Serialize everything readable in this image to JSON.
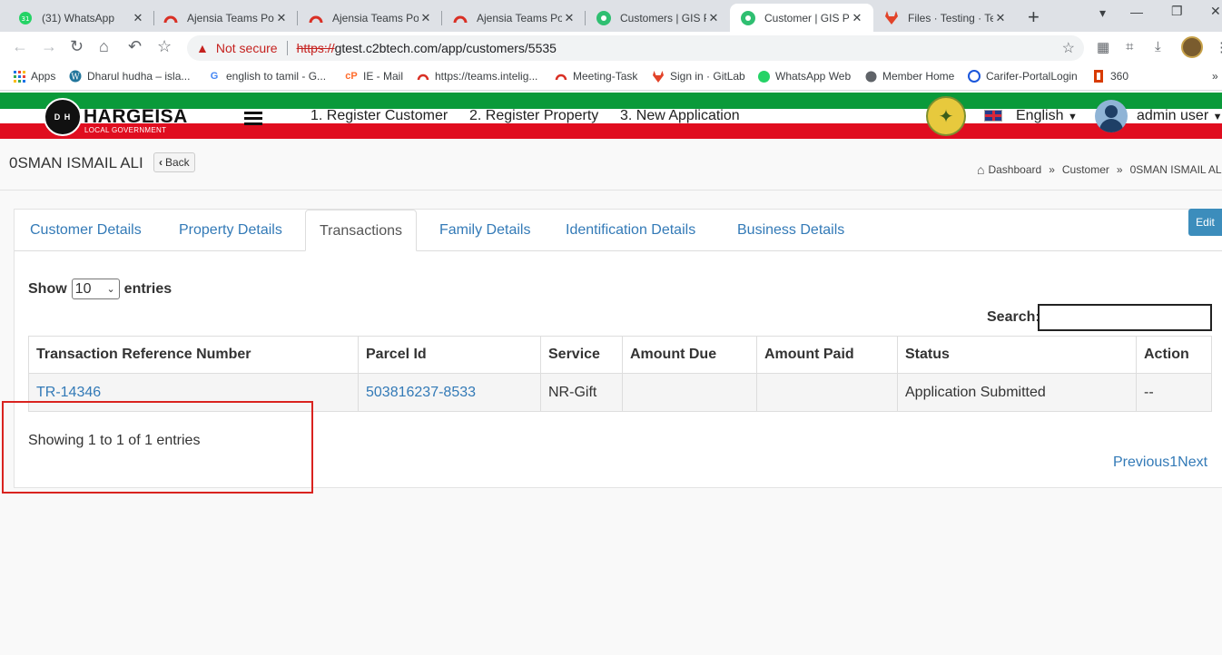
{
  "browser": {
    "tabs": [
      {
        "title": "(31) WhatsApp",
        "icon": "whatsapp-icon",
        "active": false
      },
      {
        "title": "Ajensia Teams Por",
        "icon": "teams-icon",
        "active": false
      },
      {
        "title": "Ajensia Teams Por",
        "icon": "teams-icon",
        "active": false
      },
      {
        "title": "Ajensia Teams Por",
        "icon": "teams-icon",
        "active": false
      },
      {
        "title": "Customers | GIS P",
        "icon": "gis-icon",
        "active": false
      },
      {
        "title": "Customer | GIS Po",
        "icon": "gis-icon",
        "active": true
      },
      {
        "title": "Files · Testing · Te",
        "icon": "gitlab-icon",
        "active": false
      }
    ],
    "not_secure": "Not secure",
    "url_scheme": "https://",
    "url_rest": "gtest.c2btech.com/app/customers/5535",
    "bookmarks": [
      {
        "label": "Apps",
        "icon": "apps-grid-icon"
      },
      {
        "label": "Dharul hudha – isla...",
        "icon": "wordpress-icon"
      },
      {
        "label": "english to tamil - G...",
        "icon": "google-icon"
      },
      {
        "label": "IE - Mail",
        "icon": "cpanel-icon"
      },
      {
        "label": "https://teams.intelig...",
        "icon": "teams-icon"
      },
      {
        "label": "Meeting-Task",
        "icon": "teams-icon"
      },
      {
        "label": "Sign in · GitLab",
        "icon": "gitlab-icon"
      },
      {
        "label": "WhatsApp Web",
        "icon": "whatsapp-icon"
      },
      {
        "label": "Member Home",
        "icon": "globe-icon"
      },
      {
        "label": "Carifer-PortalLogin",
        "icon": "carifer-icon"
      },
      {
        "label": "360",
        "icon": "office-icon"
      }
    ]
  },
  "header": {
    "logo_text": "HARGEISA",
    "logo_sub": "LOCAL GOVERNMENT",
    "logo_mark": "D H",
    "nav": [
      "1. Register Customer",
      "2. Register Property",
      "3. New Application"
    ],
    "language": "English",
    "user": "admin user"
  },
  "page": {
    "title": "0SMAN ISMAIL ALI",
    "back_label": "Back",
    "breadcrumb": [
      "Dashboard",
      "Customer",
      "0SMAN ISMAIL AL"
    ]
  },
  "tabs": [
    {
      "label": "Customer Details",
      "active": false
    },
    {
      "label": "Property Details",
      "active": false
    },
    {
      "label": "Transactions",
      "active": true
    },
    {
      "label": "Family Details",
      "active": false
    },
    {
      "label": "Identification Details",
      "active": false
    },
    {
      "label": "Business Details",
      "active": false
    }
  ],
  "edit_label": "Edit",
  "table_controls": {
    "show_label": "Show",
    "entries_value": "10",
    "entries_label": "entries",
    "search_label": "Search:"
  },
  "table": {
    "columns": [
      "Transaction Reference Number",
      "Parcel Id",
      "Service",
      "Amount Due",
      "Amount Paid",
      "Status",
      "Action"
    ],
    "rows": [
      [
        "TR-14346",
        "503816237-8533",
        "NR-Gift",
        "",
        "",
        "Application Submitted",
        "--"
      ]
    ]
  },
  "info_text": "Showing 1 to 1 of 1 entries",
  "pager": {
    "previous": "Previous",
    "page": "1",
    "next": "Next"
  },
  "colors": {
    "green_stripe": "#0a9a3a",
    "red_stripe": "#e00d1f",
    "link": "#337ab7",
    "edit_button": "#3c8dbc",
    "highlight_box": "#d9231f"
  }
}
